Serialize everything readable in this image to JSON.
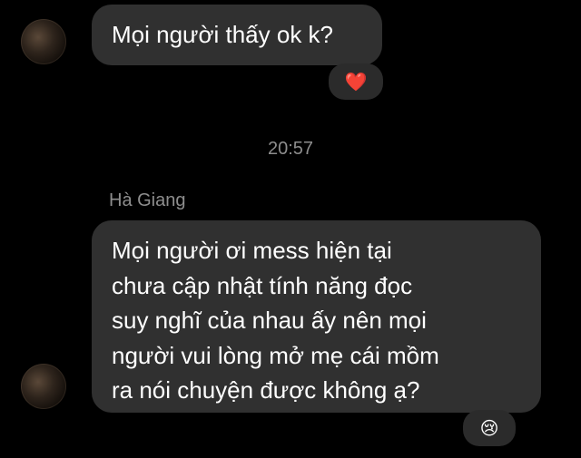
{
  "messages": [
    {
      "text": "Mọi người thấy ok k?",
      "reaction": {
        "icon": "red-heart-icon",
        "glyph": "❤️"
      }
    },
    {
      "sender": "Hà Giang",
      "lines": [
        "Mọi người ơi mess hiện tại",
        "chưa cập nhật tính năng đọc",
        "suy nghĩ của nhau ấy nên mọi",
        "người vui lòng mở mẹ cái mồm",
        "ra nói chuyện được không ạ?"
      ],
      "reaction": {
        "icon": "crying-face-icon",
        "glyph": "😢"
      }
    }
  ],
  "timestamp": "20:57",
  "colors": {
    "background": "#000000",
    "bubble": "#303030",
    "meta_text": "#8d8d8d"
  }
}
